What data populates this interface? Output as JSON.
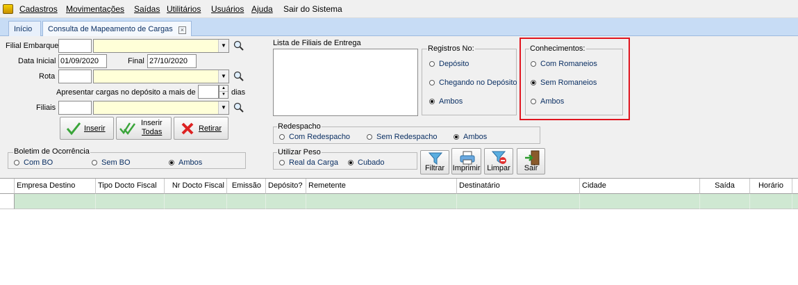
{
  "menu": {
    "items": [
      "Cadastros",
      "Movimentações",
      "Saídas",
      "Utilitários",
      "Usuários",
      "Ajuda",
      "Sair do Sistema"
    ]
  },
  "tabs": {
    "home": "Início",
    "active": "Consulta de Mapeamento de Cargas",
    "close_glyph": "⊠"
  },
  "form": {
    "filial_embarque_label": "Filial Embarque",
    "data_inicial_label": "Data Inicial",
    "data_inicial_value": "01/09/2020",
    "final_label": "Final",
    "final_value": "27/10/2020",
    "rota_label": "Rota",
    "apresentar_label": "Apresentar cargas no depósito a mais de",
    "dias_label": "dias",
    "filiais_label": "Filiais",
    "lista_filiais_label": "Lista de Filiais de Entrega"
  },
  "buttons": {
    "inserir": "Inserir",
    "inserir_todas_1": "Inserir",
    "inserir_todas_2": "Todas",
    "retirar": "Retirar",
    "filtrar": "Filtrar",
    "imprimir": "Imprimir",
    "limpar": "Limpar",
    "sair": "Sair"
  },
  "registros": {
    "title": "Registros No:",
    "options": [
      "Depósito",
      "Chegando no Depósito",
      "Ambos"
    ],
    "selected": 2
  },
  "conhecimentos": {
    "title": "Conhecimentos:",
    "options": [
      "Com Romaneios",
      "Sem Romaneios",
      "Ambos"
    ],
    "selected": 1
  },
  "redespacho": {
    "title": "Redespacho",
    "options": [
      "Com Redespacho",
      "Sem Redespacho",
      "Ambos"
    ],
    "selected": 2
  },
  "boletim": {
    "title": "Boletim de Ocorrência",
    "options": [
      "Com BO",
      "Sem BO",
      "Ambos"
    ],
    "selected": 2
  },
  "peso": {
    "title": "Utilizar Peso",
    "options": [
      "Real da Carga",
      "Cubado"
    ],
    "selected": 1
  },
  "grid": {
    "columns": [
      "Empresa Destino",
      "Tipo Docto Fiscal",
      "Nr Docto Fiscal",
      "Emissão",
      "Depósito?",
      "Remetente",
      "Destinatário",
      "Cidade",
      "Saída",
      "Horário"
    ]
  },
  "colors": {
    "highlight": "#e0141e",
    "row_selected": "#cfe8d2",
    "combo_bg": "#ffffd8",
    "tabstrip": "#c7dcf5"
  }
}
